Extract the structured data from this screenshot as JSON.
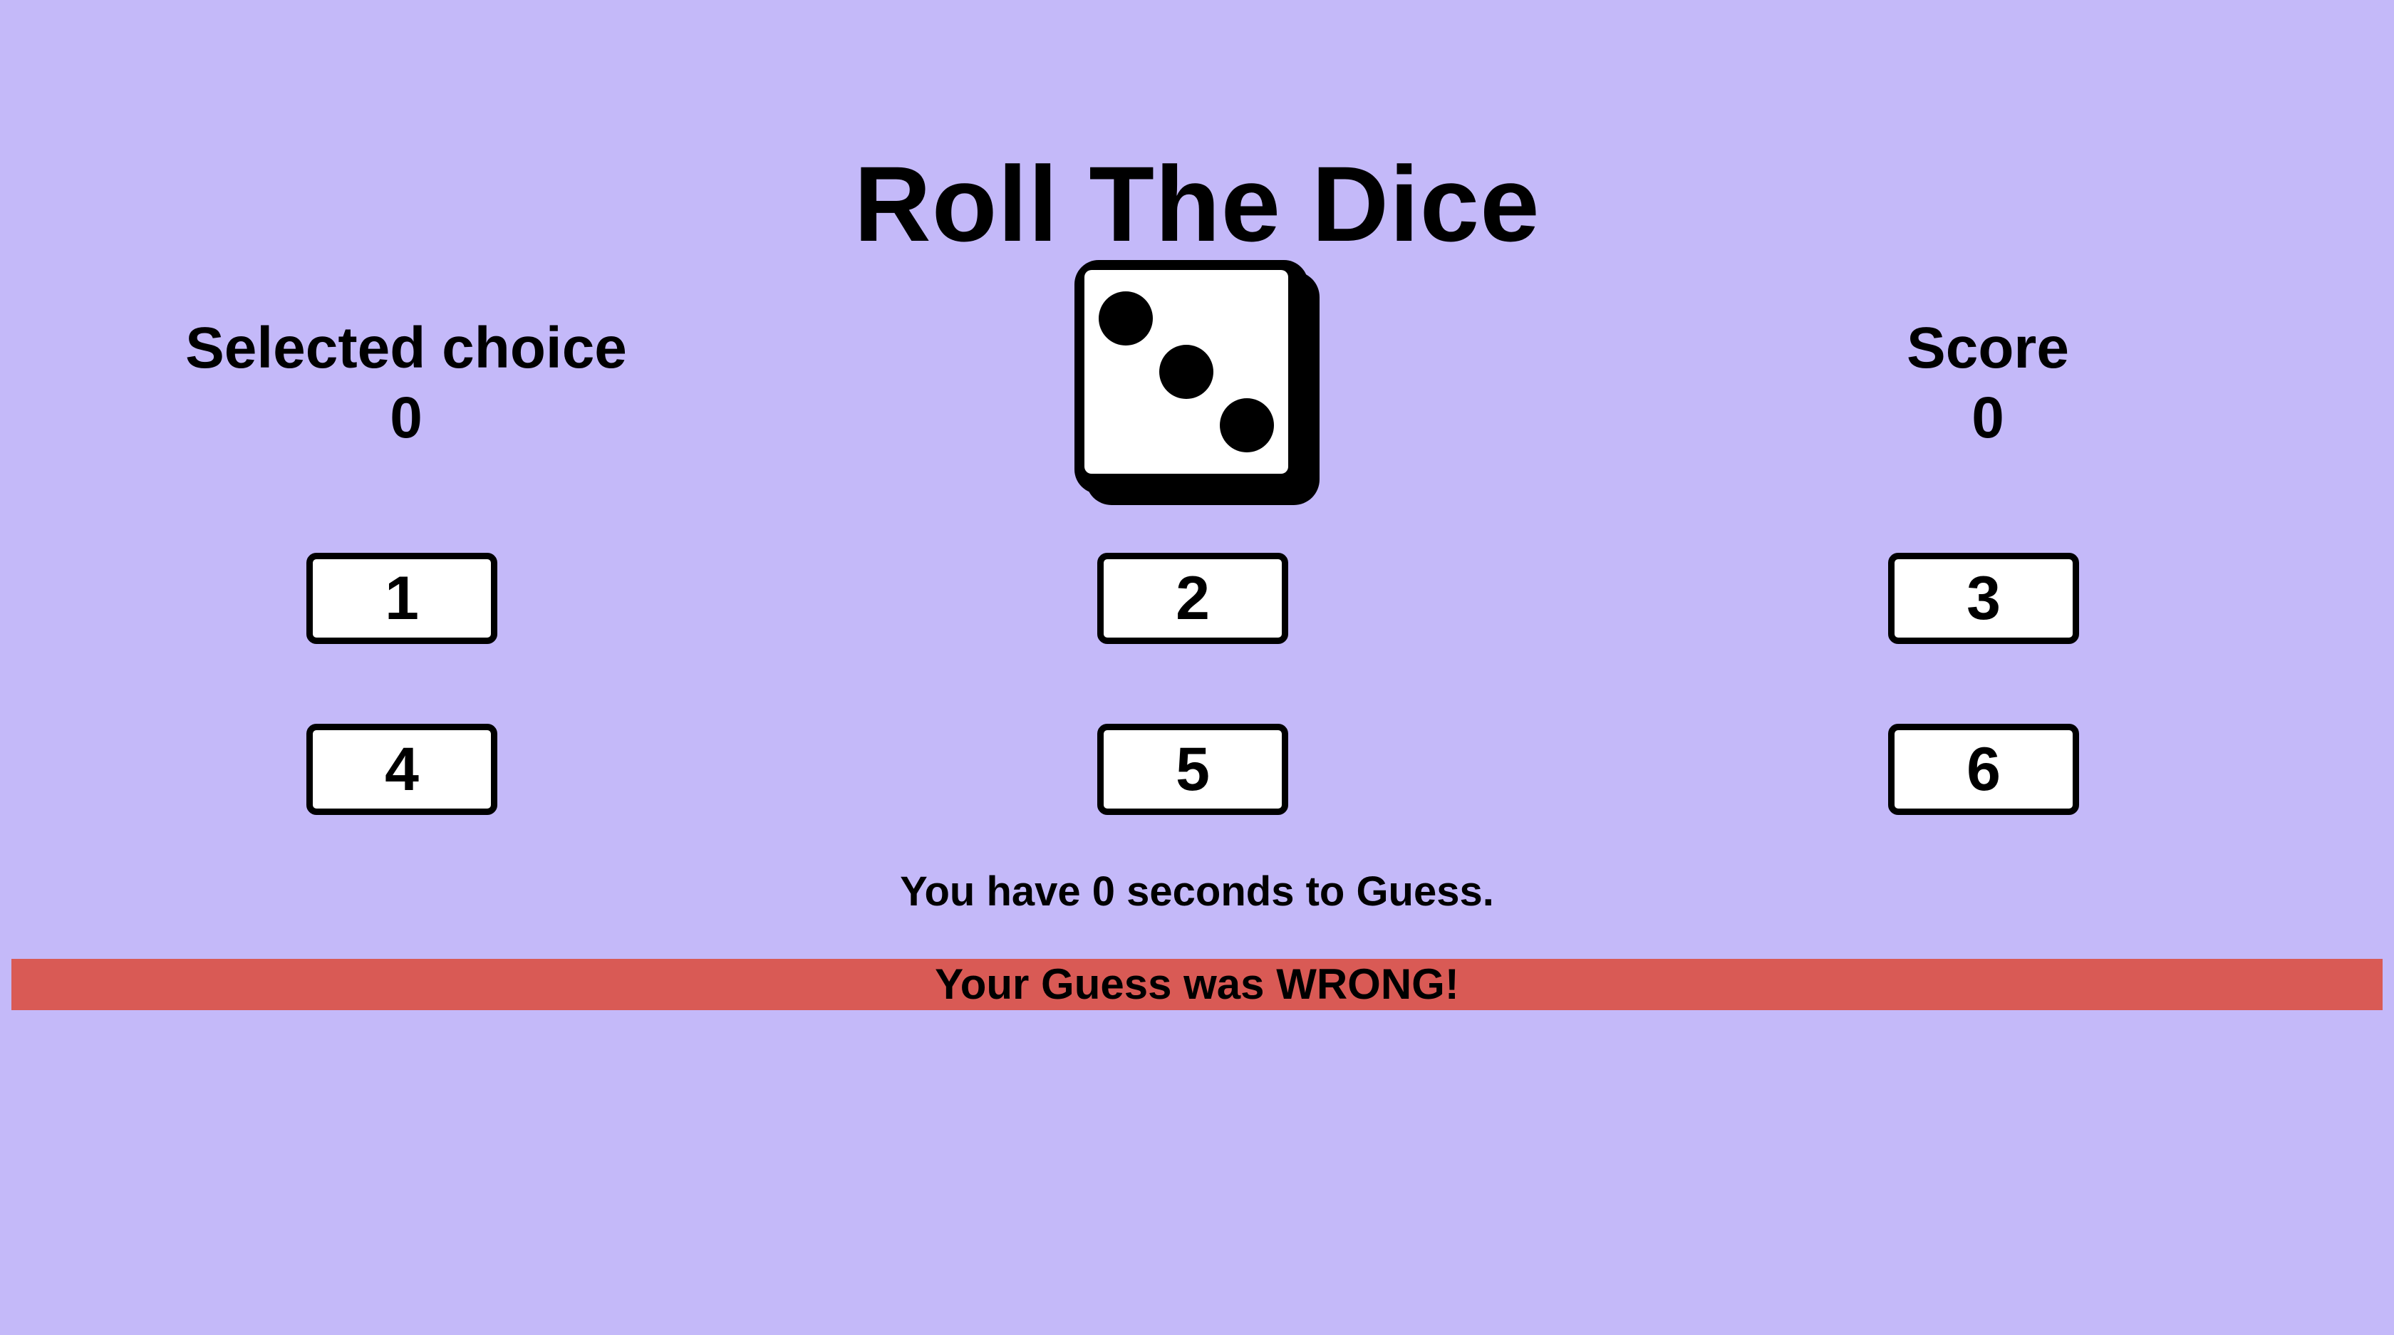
{
  "title": "Roll The Dice",
  "selected": {
    "label": "Selected choice",
    "value": "0"
  },
  "score": {
    "label": "Score",
    "value": "0"
  },
  "dice": {
    "face": 3,
    "icon": "dice-three-icon"
  },
  "choices": [
    "1",
    "2",
    "3",
    "4",
    "5",
    "6"
  ],
  "timer": {
    "text": "You have 0 seconds to Guess."
  },
  "result": {
    "text": "Your Guess was WRONG!",
    "color": "#d95a55"
  },
  "colors": {
    "background": "#c4b9f9",
    "button_bg": "#ffffff",
    "text": "#000000"
  }
}
